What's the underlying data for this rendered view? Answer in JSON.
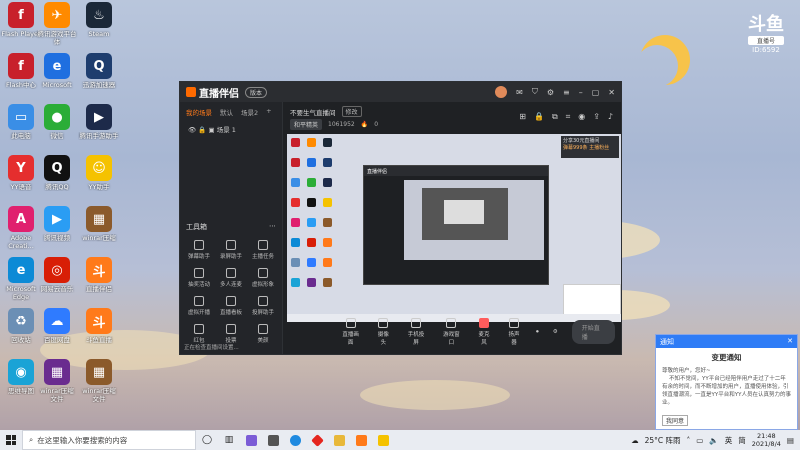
{
  "desktop": {
    "icons": [
      {
        "label": "Flash Player",
        "color": "#c8202b",
        "glyph": "f"
      },
      {
        "label": "腾讯游戏平台\n体",
        "color": "#ff8a00",
        "glyph": "✈"
      },
      {
        "label": "Steam",
        "color": "#1b2838",
        "glyph": "♨"
      },
      {
        "label": "Flash中心",
        "color": "#c8202b",
        "glyph": "f"
      },
      {
        "label": "Microsoft",
        "color": "#1f6fe0",
        "glyph": "e"
      },
      {
        "label": "迅游加速器",
        "color": "#1e3d6e",
        "glyph": "Q"
      },
      {
        "label": "此电脑",
        "color": "#3a8ee6",
        "glyph": "▭"
      },
      {
        "label": "微信",
        "color": "#2bad37",
        "glyph": "●"
      },
      {
        "label": "腾讯手游助手",
        "color": "#1d2a4a",
        "glyph": "▶"
      },
      {
        "label": "YY语音",
        "color": "#e52e2e",
        "glyph": "Y"
      },
      {
        "label": "腾讯QQ",
        "color": "#111",
        "glyph": "Q"
      },
      {
        "label": "YY助手",
        "color": "#f5c200",
        "glyph": "☺"
      },
      {
        "label": "Adobe\nCreati...",
        "color": "#e0206e",
        "glyph": "A"
      },
      {
        "label": "腾讯视频",
        "color": "#2a9df4",
        "glyph": "▶"
      },
      {
        "label": "winrar压缩",
        "color": "#8b5a2b",
        "glyph": "▦"
      },
      {
        "label": "Microsoft\nEdge",
        "color": "#0c8ad6",
        "glyph": "e"
      },
      {
        "label": "网易云音乐",
        "color": "#d81e06",
        "glyph": "◎"
      },
      {
        "label": "直播伴侣",
        "color": "#ff7a1a",
        "glyph": "斗"
      },
      {
        "label": "回收站",
        "color": "#6b8fb5",
        "glyph": "♻"
      },
      {
        "label": "百度网盘",
        "color": "#2f7bff",
        "glyph": "☁"
      },
      {
        "label": "斗鱼直播",
        "color": "#ff7a1a",
        "glyph": "斗"
      },
      {
        "label": "思维导图",
        "color": "#1aa3d6",
        "glyph": "◉"
      },
      {
        "label": "winrar压缩\n文件",
        "color": "#6a2c8f",
        "glyph": "▦"
      },
      {
        "label": "winrar压缩\n文件",
        "color": "#8b5a2b",
        "glyph": "▦"
      }
    ]
  },
  "brand": {
    "name": "斗鱼",
    "sub": "直播号",
    "id": "ID:6592"
  },
  "app": {
    "title": "直播伴侣",
    "version": "版本",
    "tabs": [
      "我的场景",
      "默认",
      "场景2"
    ],
    "scene": "场景 1",
    "tools_title": "工具箱",
    "tools": [
      "弹幕助手",
      "录屏助手",
      "主播任务",
      "抽奖活动",
      "多人连麦",
      "虚拟形象",
      "虚拟开播",
      "直播看板",
      "投屏助手",
      "红包",
      "投票",
      "美颜"
    ],
    "room_title": "不要生气直播间",
    "room_tag": "修改",
    "category": "和平精英",
    "viewer": "1061952",
    "heat": "0",
    "overlay_line1": "分享30元直播间",
    "overlay_line2": "弹幕999条 主播粉丝",
    "nested_title": "直播伴侣",
    "bottom_buttons": [
      "直播画面",
      "摄像头",
      "手机投屏",
      "游戏窗口",
      "麦克风",
      "扬声器"
    ],
    "start_live": "开始直播",
    "bottom_msg": "正在检查直播间设置..."
  },
  "notice": {
    "header": "通知",
    "title": "变更通知",
    "body": "尊敬的用户，您好~\n    不知不觉间，YY平台已经陪伴用户走过了十二年有余的时间，而不断增加的用户，直播使用体验，引领直播潮流，一直是YY平台和YY人员在认真努力的事业。",
    "button": "我同意"
  },
  "taskbar": {
    "search_placeholder": "在这里输入你要搜索的内容",
    "weather": "25°C 阵雨",
    "ime": "英",
    "ime2": "简",
    "time": "21:48",
    "date": "2021/8/4"
  }
}
